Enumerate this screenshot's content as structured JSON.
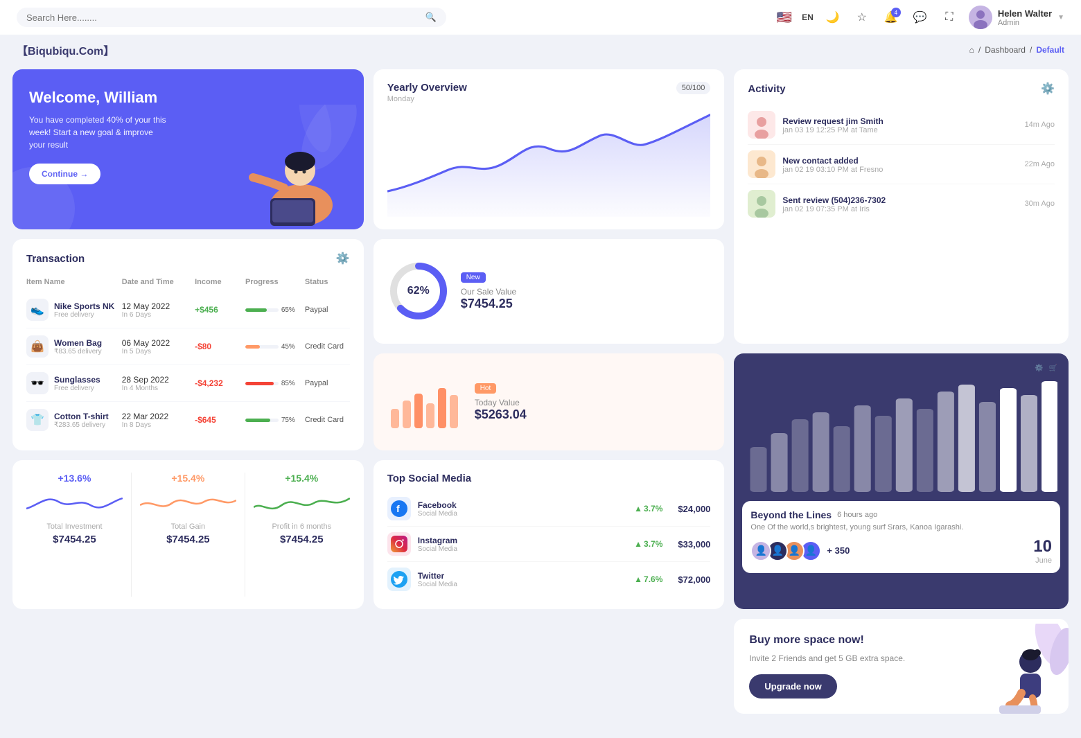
{
  "topnav": {
    "search_placeholder": "Search Here........",
    "lang": "EN",
    "user_name": "Helen Walter",
    "user_role": "Admin",
    "notification_count": "4"
  },
  "breadcrumb": {
    "brand": "【Biqubiqu.Com】",
    "home": "⌂",
    "path1": "Dashboard",
    "path2": "Default"
  },
  "welcome": {
    "title": "Welcome, William",
    "subtitle": "You have completed 40% of your this week! Start a new goal & improve your result",
    "button": "Continue →"
  },
  "yearly_overview": {
    "title": "Yearly Overview",
    "day": "Monday",
    "badge": "50/100"
  },
  "activity": {
    "title": "Activity",
    "items": [
      {
        "title": "Review request jim Smith",
        "subtitle": "jan 03 19 12:25 PM at Tame",
        "time": "14m Ago"
      },
      {
        "title": "New contact added",
        "subtitle": "jan 02 19 03:10 PM at Fresno",
        "time": "22m Ago"
      },
      {
        "title": "Sent review (504)236-7302",
        "subtitle": "jan 02 19 07:35 PM at Iris",
        "time": "30m Ago"
      }
    ]
  },
  "transaction": {
    "title": "Transaction",
    "columns": [
      "Item Name",
      "Date and Time",
      "Income",
      "Progress",
      "Status"
    ],
    "rows": [
      {
        "icon": "👟",
        "name": "Nike Sports NK",
        "sub": "Free delivery",
        "date": "12 May 2022",
        "date_sub": "In 6 Days",
        "income": "+$456",
        "income_type": "pos",
        "progress": 65,
        "progress_color": "#4caf50",
        "status": "Paypal"
      },
      {
        "icon": "👜",
        "name": "Women Bag",
        "sub": "₹83.65 delivery",
        "date": "06 May 2022",
        "date_sub": "In 5 Days",
        "income": "-$80",
        "income_type": "neg",
        "progress": 45,
        "progress_color": "#ff9966",
        "status": "Credit Card"
      },
      {
        "icon": "🕶️",
        "name": "Sunglasses",
        "sub": "Free delivery",
        "date": "28 Sep 2022",
        "date_sub": "In 4 Months",
        "income": "-$4,232",
        "income_type": "neg",
        "progress": 85,
        "progress_color": "#f44336",
        "status": "Paypal"
      },
      {
        "icon": "👕",
        "name": "Cotton T-shirt",
        "sub": "₹283.65 delivery",
        "date": "22 Mar 2022",
        "date_sub": "In 8 Days",
        "income": "-$645",
        "income_type": "neg",
        "progress": 75,
        "progress_color": "#4caf50",
        "status": "Credit Card"
      }
    ]
  },
  "sale_value": {
    "donut_pct": "62%",
    "badge": "New",
    "label": "Our Sale Value",
    "value": "$7454.25"
  },
  "today_value": {
    "badge": "Hot",
    "label": "Today Value",
    "value": "$5263.04"
  },
  "bar_chart": {
    "title": "Beyond the Lines",
    "time_ago": "6 hours ago",
    "description": "One Of the world,s brightest, young surf Srars, Kanoa Igarashi.",
    "plus_count": "+ 350",
    "date_num": "10",
    "date_month": "June"
  },
  "stats": [
    {
      "pct": "+13.6%",
      "label": "Total Investment",
      "value": "$7454.25",
      "color": "#5b5ef4"
    },
    {
      "pct": "+15.4%",
      "label": "Total Gain",
      "value": "$7454.25",
      "color": "#ff9966"
    },
    {
      "pct": "+15.4%",
      "label": "Profit in 6 months",
      "value": "$7454.25",
      "color": "#4caf50"
    }
  ],
  "social_media": {
    "title": "Top Social Media",
    "items": [
      {
        "icon": "📘",
        "name": "Facebook",
        "type": "Social Media",
        "pct": "3.7%",
        "amount": "$24,000",
        "icon_color": "#1877f2"
      },
      {
        "icon": "📷",
        "name": "Instagram",
        "type": "Social Media",
        "pct": "3.7%",
        "amount": "$33,000",
        "icon_color": "#e1306c"
      },
      {
        "icon": "🐦",
        "name": "Twitter",
        "type": "Social Media",
        "pct": "7.6%",
        "amount": "$72,000",
        "icon_color": "#1da1f2"
      }
    ]
  },
  "buy_space": {
    "title": "Buy more space now!",
    "description": "Invite 2 Friends and get 5 GB extra space.",
    "button": "Upgrade now"
  }
}
